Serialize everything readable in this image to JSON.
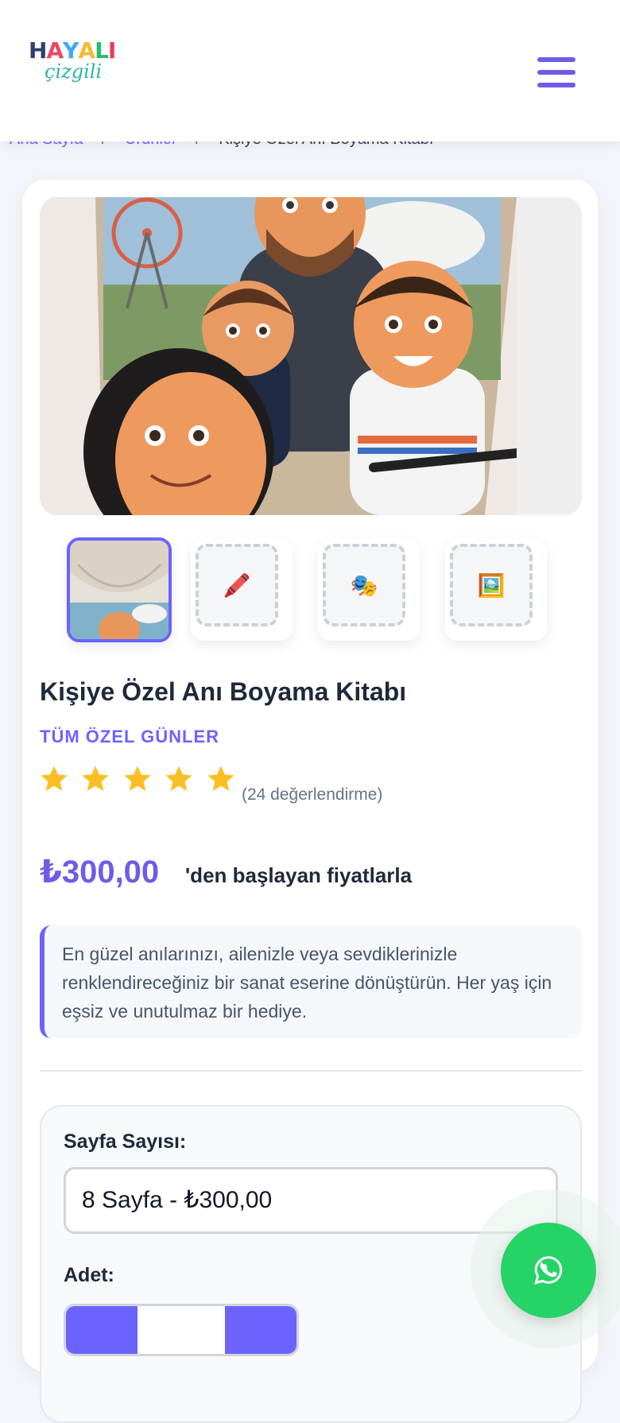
{
  "header": {
    "logo_top": "HAYALI",
    "logo_bottom": "çizgili",
    "menu_icon": "hamburger-icon"
  },
  "breadcrumb": {
    "home": "Ana Sayfa",
    "products": "Ürünler",
    "current": "Kişiye Özel Anı Boyama Kitabı",
    "separator": "/"
  },
  "gallery": {
    "thumbnails": [
      {
        "icon": "photo-thumbnail",
        "active": true
      },
      {
        "icon": "crayon-icon",
        "glyph": "🖍️"
      },
      {
        "icon": "theater-masks-icon",
        "glyph": "🎭"
      },
      {
        "icon": "framed-picture-icon",
        "glyph": "🖼️"
      }
    ]
  },
  "product": {
    "title": "Kişiye Özel Anı Boyama Kitabı",
    "category": "TÜM ÖZEL GÜNLER",
    "rating": 5,
    "reviews": "(24 değerlendirme)",
    "price": "₺300,00",
    "price_suffix": "'den başlayan fiyatlarla",
    "description": "En güzel anılarınızı, ailenizle veya sevdiklerinizle renklendireceğiniz bir sanat eserine dönüştürün. Her yaş için eşsiz ve unutulmaz bir hediye."
  },
  "options": {
    "page_label": "Sayfa Sayısı:",
    "page_value": "8 Sayfa - ₺300,00",
    "qty_label": "Adet:"
  },
  "colors": {
    "accent": "#6c63ff",
    "star": "#fbbf24",
    "whatsapp": "#25d366"
  }
}
